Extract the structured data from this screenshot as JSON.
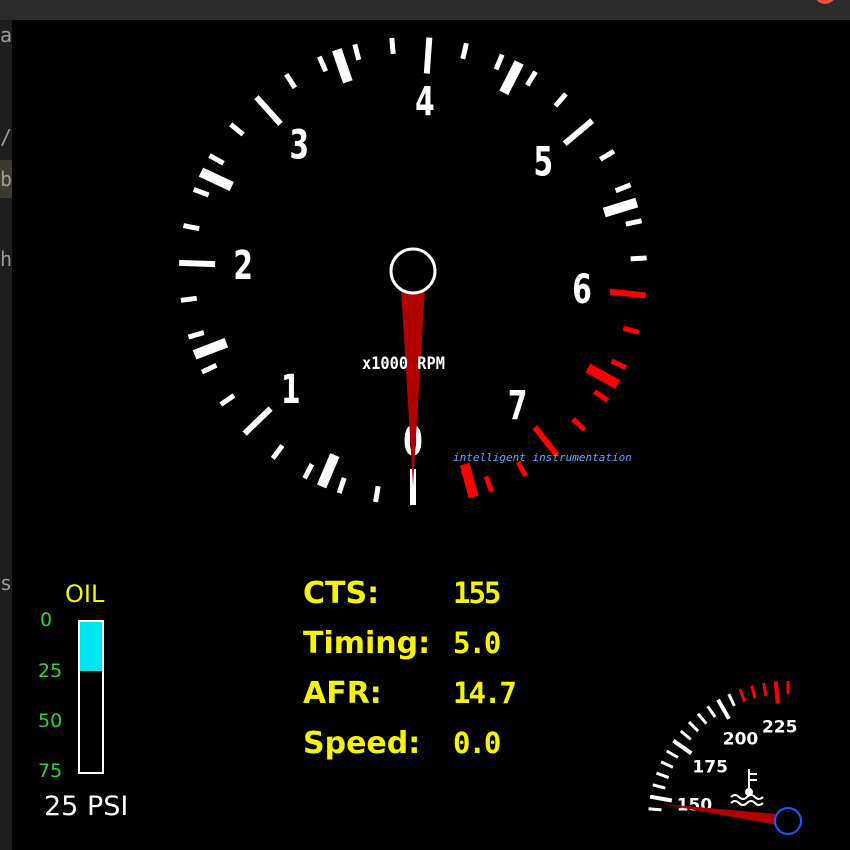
{
  "window": {
    "close_button_color": "#e0543e"
  },
  "side_strip_chars": [
    "a",
    "/",
    "b",
    "h",
    "s"
  ],
  "tachometer": {
    "labels": [
      "0",
      "1",
      "2",
      "3",
      "4",
      "5",
      "6",
      "7"
    ],
    "unit": "x1000 RPM",
    "brand": "intelligent instrumentation",
    "redline_start": 6,
    "needle_rpm": 0,
    "needle_color": "#b00000",
    "redline_color": "#ff0000"
  },
  "readouts": [
    {
      "label": "CTS:",
      "value": "155"
    },
    {
      "label": "Timing:",
      "value": "5.0"
    },
    {
      "label": "AFR:",
      "value": "14.7"
    },
    {
      "label": "Speed:",
      "value": "0.0"
    }
  ],
  "oil": {
    "title": "OIL",
    "scale": [
      "0",
      "25",
      "50",
      "75"
    ],
    "pressure_psi": 25,
    "max_psi": 75,
    "readout": "25 PSI",
    "fill_color": "#00e5ee"
  },
  "coolant_gauge": {
    "labels": [
      "150",
      "175",
      "200",
      "225"
    ],
    "icon": "coolant-temperature-icon",
    "needle_value": 150
  }
}
